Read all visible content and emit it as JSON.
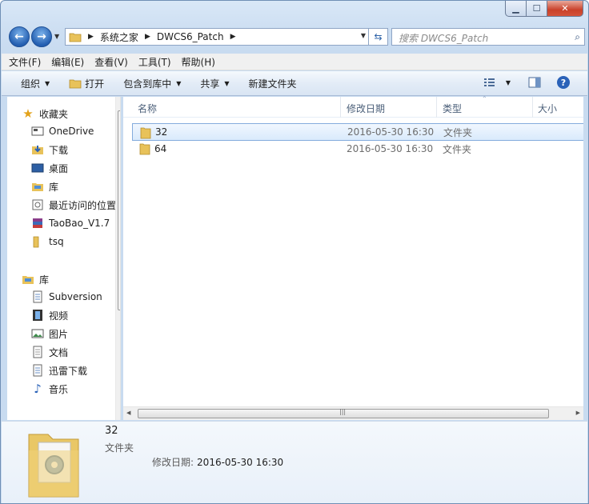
{
  "caption": {
    "min": "▁",
    "max": "☐",
    "close": "✕"
  },
  "address": {
    "crumbs": [
      "系统之家",
      "DWCS6_Patch"
    ],
    "search_placeholder": "搜索 DWCS6_Patch"
  },
  "menu": [
    "文件(F)",
    "编辑(E)",
    "查看(V)",
    "工具(T)",
    "帮助(H)"
  ],
  "toolbar": {
    "organize": "组织",
    "open": "打开",
    "include_library": "包含到库中",
    "share": "共享",
    "new_folder": "新建文件夹"
  },
  "nav": {
    "favorites_label": "收藏夹",
    "favorites": [
      "OneDrive",
      "下载",
      "桌面",
      "库",
      "最近访问的位置",
      "TaoBao_V1.7",
      "tsq"
    ],
    "library_label": "库",
    "libraries": [
      "Subversion",
      "视频",
      "图片",
      "文档",
      "迅雷下载",
      "音乐"
    ]
  },
  "columns": {
    "name": "名称",
    "modified": "修改日期",
    "type": "类型",
    "size": "大小"
  },
  "files": [
    {
      "name": "32",
      "modified": "2016-05-30 16:30",
      "type": "文件夹"
    },
    {
      "name": "64",
      "modified": "2016-05-30 16:30",
      "type": "文件夹"
    }
  ],
  "details": {
    "name": "32",
    "type": "文件夹",
    "modified_label": "修改日期:",
    "modified_value": "2016-05-30 16:30"
  },
  "colors": {
    "selection": "#d9eafc",
    "accent": "#245fb1"
  }
}
